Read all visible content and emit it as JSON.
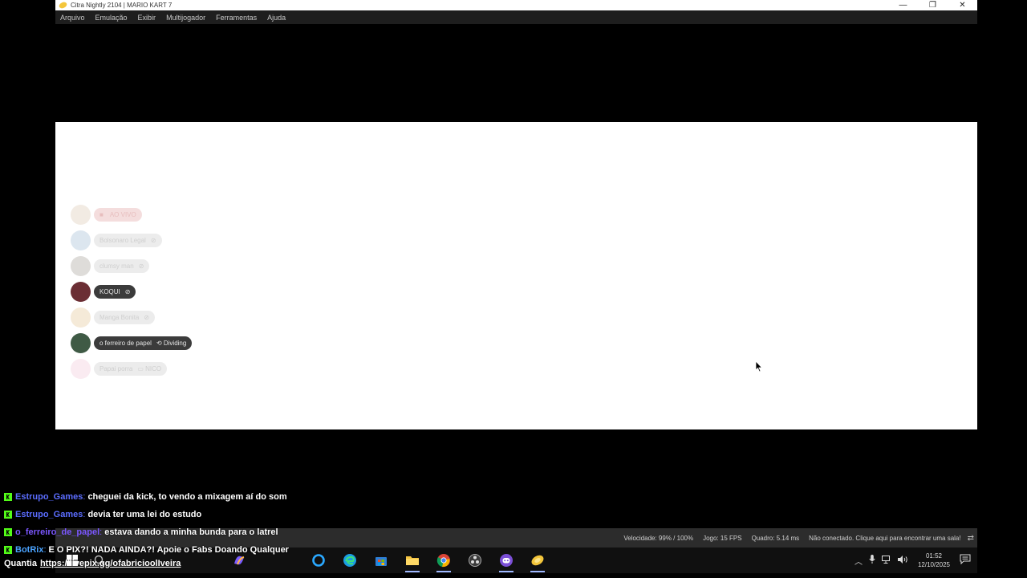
{
  "window": {
    "title": "Citra Nightly 2104 | MARIO KART 7",
    "controls": {
      "minimize": "—",
      "restore": "❐",
      "close": "✕"
    }
  },
  "menu": [
    "Arquivo",
    "Emulação",
    "Exibir",
    "Multijogador",
    "Ferramentas",
    "Ajuda"
  ],
  "voice_overlay": [
    {
      "name": "AO VIVO",
      "prefix": "■",
      "style": "live",
      "avatar_color": "#d9c7b0",
      "faded": true
    },
    {
      "name": "Bolsonaro Legal",
      "icon": "⊘",
      "style": "gray",
      "avatar_color": "#9bb7d1",
      "faded": true
    },
    {
      "name": "clumsy man",
      "icon": "⊘",
      "style": "gray",
      "avatar_color": "#a09a93",
      "faded": true
    },
    {
      "name": "KOQUI",
      "icon": "⊘",
      "style": "dark",
      "avatar_color": "#6b2e34",
      "faded": false
    },
    {
      "name": "Manga Bonita",
      "icon": "⊘",
      "style": "gray",
      "avatar_color": "#e2c48e",
      "faded": true
    },
    {
      "name": "o ferreiro de papel",
      "icon": "⟲ Dividing",
      "style": "dark",
      "avatar_color": "#3f5a45",
      "faded": false
    },
    {
      "name": "Papai porra",
      "icon": "▭ NICO",
      "style": "gray",
      "avatar_color": "#f2c6d6",
      "faded": true
    }
  ],
  "status": {
    "speed": "Velocidade: 99% / 100%",
    "game_fps": "Jogo: 15 FPS",
    "frame": "Quadro: 5.14 ms",
    "connection": "Não conectado. Clique aqui para encontrar uma sala!"
  },
  "chat": [
    {
      "user": "Estrupo_Games",
      "sep": ":",
      "message": "cheguei da kick, to vendo a mixagem aí do som",
      "user_color": "#5b6dff"
    },
    {
      "user": "Estrupo_Games",
      "sep": ":",
      "message": "devia ter uma lei do estudo",
      "user_color": "#5b6dff"
    },
    {
      "user": "o_ferreiro_de_papel",
      "sep": ":",
      "message": "estava dando a minha bunda para o latrel",
      "user_color": "#7b57ff"
    },
    {
      "user": "BotRix",
      "sep": ":",
      "message": "E O PIX?! NADA AINDA?! Apoie o Fabs Doando Qualquer",
      "user_color": "#4aa3ff"
    }
  ],
  "chat_continuation": {
    "text": "Quantia",
    "link": "https://livepix.gg/ofabricioolIveira"
  },
  "clock": {
    "time": "01:52",
    "date": "12/10/2025"
  },
  "colors": {
    "accent_kick": "#53fc18",
    "statusbar": "#2c2c2c",
    "menubar": "#1e1e1e"
  }
}
